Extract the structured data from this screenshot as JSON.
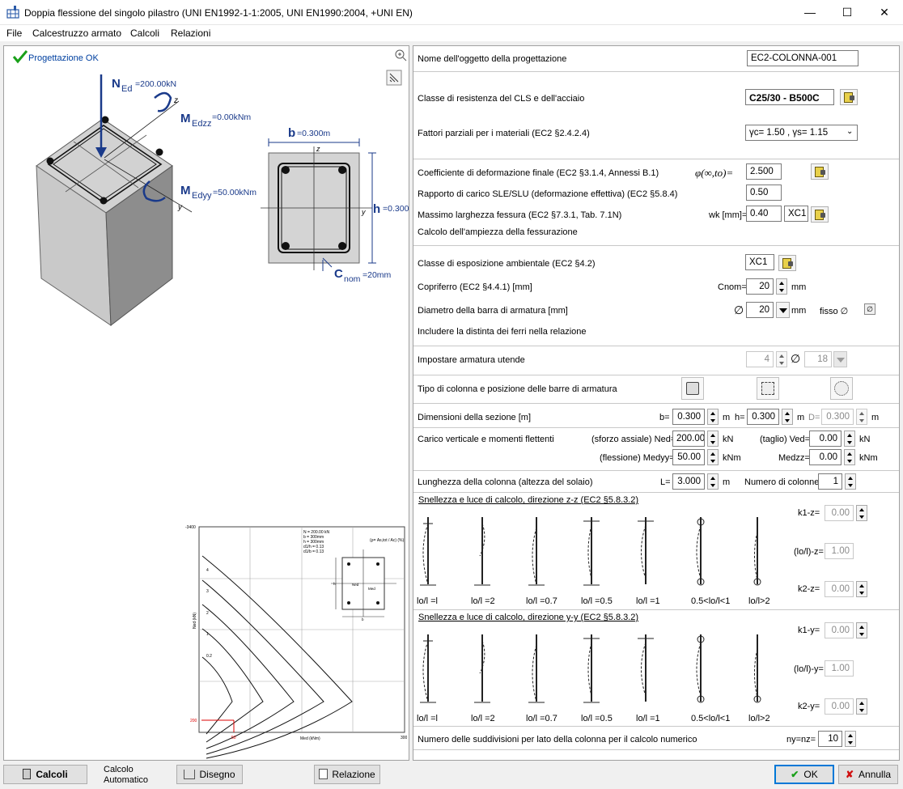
{
  "window": {
    "title": "Doppia flessione del singolo pilastro (UNI EN1992-1-1:2005, UNI EN1990:2004, +UNI EN)"
  },
  "menu": [
    "File",
    "Calcestruzzo armato",
    "Calcoli",
    "Relazioni"
  ],
  "left": {
    "status": "Progettazione OK",
    "column_labels": {
      "ned": "N",
      "ned_sub": "Ed",
      "ned_val": "=200.00kN",
      "medzz": "M",
      "medzz_sub": "Edzz",
      "medzz_val": "=0.00kNm",
      "medyy": "M",
      "medyy_sub": "Edyy",
      "medyy_val": "=50.00kNm",
      "z": "z",
      "y": "y"
    },
    "section_labels": {
      "b": "b",
      "b_val": "=0.300m",
      "h": "h",
      "h_val": "=0.300m",
      "cnom": "C",
      "cnom_sub": "nom",
      "cnom_val": "=20mm",
      "z": "z",
      "y": "y"
    },
    "chart": {
      "ytick": "-3400",
      "y200": "200",
      "x50": "50",
      "x300": "300",
      "ylabel": "Ned (kN)",
      "xlabel": "Med (kNm)",
      "info": [
        "N = 200.00 kN",
        "b = 300mm",
        "h = 300mm",
        "d1/h = 0.13",
        "d1/b = 0.13"
      ],
      "ratio": "(ρ= As,tot / Ac) (%)",
      "curves": [
        "4",
        "3",
        "2",
        "1",
        "0.2"
      ],
      "inset": {
        "ned": "Ned",
        "med": "Med",
        "h": "h",
        "b": "b"
      }
    }
  },
  "form": {
    "nome_label": "Nome dell'oggetto della progettazione",
    "nome_value": "EC2-COLONNA-001",
    "classe_label": "Classe di resistenza del CLS e dell'acciaio",
    "classe_value": "C25/30 - B500C",
    "fattori_label": "Fattori parziali per i materiali (EC2 §2.4.2.4)",
    "fattori_value": "γc= 1.50 , γs= 1.15",
    "coeff_label": "Coefficiente di deformazione finale (EC2 §3.1.4, Annessi B.1)",
    "coeff_sym": "φ(∞,to)=",
    "coeff_value": "2.500",
    "rapporto_label": "Rapporto di carico  SLE/SLU (deformazione effettiva) (EC2 §5.8.4)",
    "rapporto_value": "0.50",
    "fessura_label": "Massimo larghezza fessura (EC2 §7.3.1, Tab. 7.1N)",
    "wk_label": "wk [mm]=",
    "wk_value": "0.40",
    "wk_class": "XC1",
    "calcolo_fess_label": "Calcolo dell'ampiezza della fessurazione",
    "esposizione_label": "Classe di esposizione ambientale (EC2 §4.2)",
    "esposizione_value": "XC1",
    "copriferro_label": "Copriferro (EC2 §4.4.1) [mm]",
    "cnom_label": "Cnom=",
    "cnom_value": "20",
    "cnom_unit": "mm",
    "diametro_label": "Diametro della barra di armatura [mm]",
    "diam_sym": "∅",
    "diam_value": "20",
    "diam_unit": "mm",
    "fisso_label": "fisso ∅",
    "distinta_label": "Includere la distinta dei ferri nella relazione",
    "armatura_label": "Impostare armatura utende",
    "arm_n": "4",
    "arm_sym": "∅",
    "arm_d": "18",
    "tipo_label": "Tipo di colonna e posizione delle barre di armatura",
    "dim_label": "Dimensioni della sezione [m]",
    "b_label": "b=",
    "b_value": "0.300",
    "b_unit": "m",
    "h_label": "h=",
    "h_value": "0.300",
    "h_unit": "m",
    "d_label": "D=",
    "d_value": "0.300",
    "d_unit": "m",
    "carico_label": "Carico verticale e momenti flettenti",
    "ned_label": "(sforzo assiale) Ned=",
    "ned_value": "200.00",
    "ned_unit": "kN",
    "ved_label": "(taglio) Ved=",
    "ved_value": "0.00",
    "ved_unit": "kN",
    "medyy_label": "(flessione) Medyy=",
    "medyy_value": "50.00",
    "medyy_unit": "kNm",
    "medzz_label": "Medzz=",
    "medzz_value": "0.00",
    "medzz_unit": "kNm",
    "lung_label": "Lunghezza della colonna (altezza del solaio)",
    "l_label": "L=",
    "l_value": "3.000",
    "l_unit": "m",
    "ncol_label": "Numero di colonne",
    "ncol_value": "1",
    "snell_z_title": "Snellezza e luce di calcolo, direzione  z-z (EC2 §5.8.3.2)",
    "snell_y_title": "Snellezza e luce di calcolo, direzione  y-y (EC2 §5.8.3.2)",
    "schemes": [
      "lo/l =l",
      "lo/l =2",
      "lo/l =0.7",
      "lo/l =0.5",
      "lo/l =1",
      "0.5<lo/l<1",
      "lo/l>2"
    ],
    "k1z_label": "k1-z=",
    "k1z_value": "0.00",
    "loz_label": "(lo/l)-z=",
    "loz_value": "1.00",
    "k2z_label": "k2-z=",
    "k2z_value": "0.00",
    "k1y_label": "k1-y=",
    "k1y_value": "0.00",
    "loy_label": "(lo/l)-y=",
    "loy_value": "1.00",
    "k2y_label": "k2-y=",
    "k2y_value": "0.00",
    "suddiv_label": "Numero delle suddivisioni per lato della colonna per il calcolo numerico",
    "nynz_label": "ny=nz=",
    "nynz_value": "10"
  },
  "bottom": {
    "calcoli": "Calcoli",
    "calcolo_auto_1": "Calcolo",
    "calcolo_auto_2": "Automatico",
    "disegno": "Disegno",
    "relazione": "Relazione",
    "ok": "OK",
    "annulla": "Annulla"
  }
}
